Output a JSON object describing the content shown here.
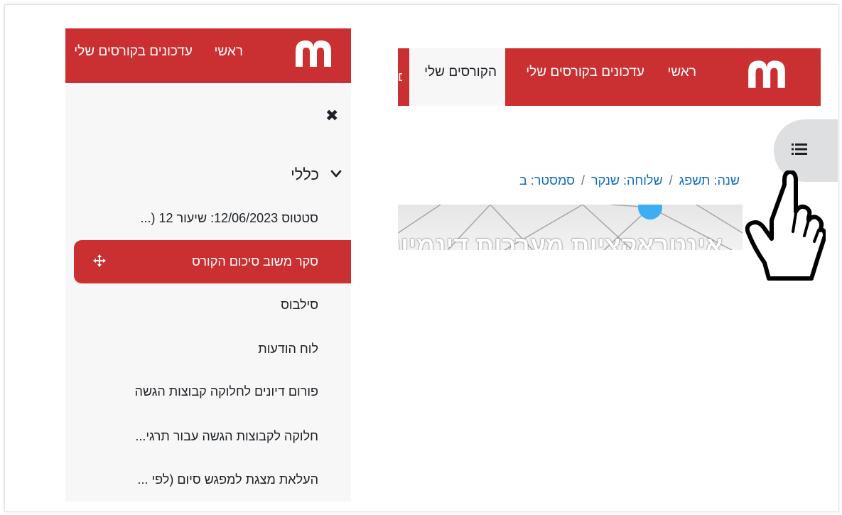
{
  "colors": {
    "brand": "#ca3032",
    "drawer_bg": "#f7f7f8",
    "link": "#0f6cbf",
    "text": "#1d2125",
    "toggle_bg": "#dedfe1"
  },
  "drawer": {
    "nav": {
      "logo_icon": "moodle-m-logo-icon",
      "home": "ראשי",
      "updates": "עדכונים בקורסים שלי"
    },
    "close_icon": "close-icon",
    "section": {
      "title": "כללי",
      "chevron_icon": "chevron-down-icon"
    },
    "items": [
      "סטטוס 12/06/2023: שיעור 12 (...",
      "סקר משוב סיכום הקורס",
      "סילבוס",
      "לוח הודעות",
      "פורום דיונים לחלוקה קבוצות הגשה",
      "חלוקה לקבוצות הגשה עבור תרגי...",
      "העלאת מצגת למפגש סיום (לפי ..."
    ],
    "active_item_icon": "move-icon"
  },
  "course": {
    "nav": {
      "logo_icon": "moodle-m-logo-icon",
      "home": "ראשי",
      "updates": "עדכונים בקורסים שלי",
      "my_courses": "הקורסים שלי"
    },
    "index_toggle_icon": "list-icon",
    "breadcrumb": [
      "שנה: תשפג",
      "שלוחה: שנקר",
      "סמסטר: ב"
    ],
    "breadcrumb_separator": "/",
    "banner_title": "אינטראקציות מערכות דינמיות"
  },
  "cursor_icon": "hand-pointer-cursor-icon"
}
